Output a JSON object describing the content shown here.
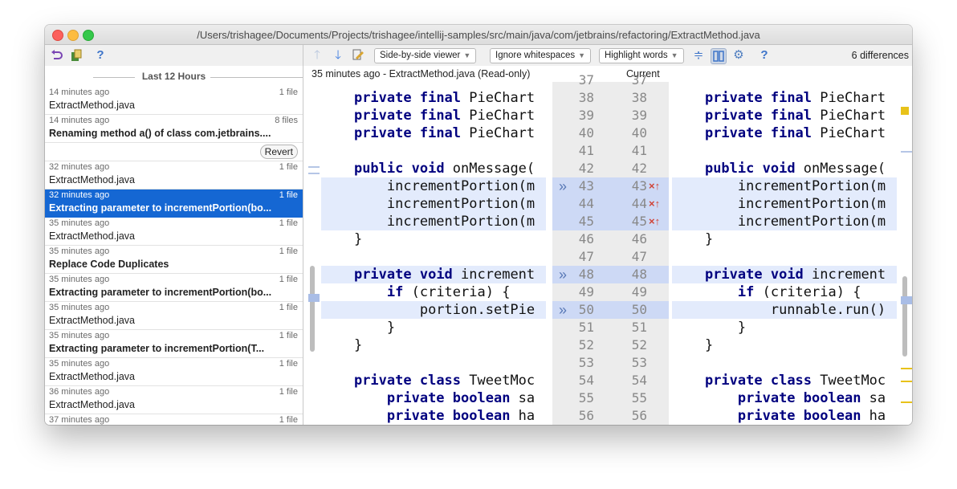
{
  "window": {
    "title": "/Users/trishagee/Documents/Projects/trishagee/intellij-samples/src/main/java/com/jetbrains/refactoring/ExtractMethod.java"
  },
  "left_toolbar": {
    "undo_icon": "undo-icon",
    "copy_icon": "copy-icon",
    "help_label": "?"
  },
  "history": {
    "group_label": "Last 12 Hours",
    "revert_label": "Revert",
    "items": [
      {
        "time": "14 minutes ago",
        "count": "1 file",
        "name": "ExtractMethod.java",
        "bold": false
      },
      {
        "time": "14 minutes ago",
        "count": "8 files",
        "name": "Renaming method a() of class com.jetbrains....",
        "bold": true
      },
      {
        "time": "32 minutes ago",
        "count": "1 file",
        "name": "ExtractMethod.java",
        "bold": false
      },
      {
        "time": "32 minutes ago",
        "count": "1 file",
        "name": "Extracting parameter to incrementPortion(bo...",
        "bold": true
      },
      {
        "time": "35 minutes ago",
        "count": "1 file",
        "name": "ExtractMethod.java",
        "bold": false
      },
      {
        "time": "35 minutes ago",
        "count": "1 file",
        "name": "Replace Code Duplicates",
        "bold": true
      },
      {
        "time": "35 minutes ago",
        "count": "1 file",
        "name": "Extracting parameter to incrementPortion(bo...",
        "bold": true
      },
      {
        "time": "35 minutes ago",
        "count": "1 file",
        "name": "ExtractMethod.java",
        "bold": false
      },
      {
        "time": "35 minutes ago",
        "count": "1 file",
        "name": "Extracting parameter to incrementPortion(T...",
        "bold": true
      },
      {
        "time": "35 minutes ago",
        "count": "1 file",
        "name": "ExtractMethod.java",
        "bold": false
      },
      {
        "time": "36 minutes ago",
        "count": "1 file",
        "name": "ExtractMethod.java",
        "bold": false
      },
      {
        "time": "37 minutes ago",
        "count": "1 file",
        "name": "ExtractMethod.java",
        "bold": false
      }
    ]
  },
  "diff_toolbar": {
    "viewer_mode": "Side-by-side viewer",
    "whitespace_mode": "Ignore whitespaces",
    "highlight_mode": "Highlight words",
    "help_label": "?",
    "differences": "6 differences"
  },
  "left_pane": {
    "header": "35 minutes ago - ExtractMethod.java (Read-only)"
  },
  "right_pane": {
    "header": "Current"
  },
  "colors": {
    "selection": "#1567d3",
    "diff_highlight": "#e3ebfc",
    "gutter_highlight": "#cdd9f5",
    "keyword": "#00007f"
  },
  "left_code": [
    {
      "indent": "    ",
      "segments": [
        {
          "t": "private ",
          "k": true
        },
        {
          "t": "final ",
          "k": true
        },
        {
          "t": "PieChart",
          "k": false
        }
      ],
      "hl": false
    },
    {
      "indent": "    ",
      "segments": [
        {
          "t": "private ",
          "k": true
        },
        {
          "t": "final ",
          "k": true
        },
        {
          "t": "PieChart",
          "k": false
        }
      ],
      "hl": false
    },
    {
      "indent": "    ",
      "segments": [
        {
          "t": "private ",
          "k": true
        },
        {
          "t": "final ",
          "k": true
        },
        {
          "t": "PieChart",
          "k": false
        }
      ],
      "hl": false
    },
    {
      "indent": "",
      "segments": [],
      "hl": false
    },
    {
      "indent": "    ",
      "segments": [
        {
          "t": "public ",
          "k": true
        },
        {
          "t": "void ",
          "k": true
        },
        {
          "t": "onMessage(",
          "k": false
        }
      ],
      "hl": false
    },
    {
      "indent": "        ",
      "segments": [
        {
          "t": "incrementPortion(m",
          "k": false
        }
      ],
      "hl": true
    },
    {
      "indent": "        ",
      "segments": [
        {
          "t": "incrementPortion(m",
          "k": false
        }
      ],
      "hl": true
    },
    {
      "indent": "        ",
      "segments": [
        {
          "t": "incrementPortion(m",
          "k": false
        }
      ],
      "hl": true
    },
    {
      "indent": "    ",
      "segments": [
        {
          "t": "}",
          "k": false
        }
      ],
      "hl": false
    },
    {
      "indent": "",
      "segments": [],
      "hl": false
    },
    {
      "indent": "    ",
      "segments": [
        {
          "t": "private ",
          "k": true
        },
        {
          "t": "void ",
          "k": true
        },
        {
          "t": "increment",
          "k": false
        }
      ],
      "hl": true
    },
    {
      "indent": "        ",
      "segments": [
        {
          "t": "if ",
          "k": true
        },
        {
          "t": "(criteria) {",
          "k": false
        }
      ],
      "hl": false
    },
    {
      "indent": "            ",
      "segments": [
        {
          "t": "portion.setPie",
          "k": false
        }
      ],
      "hl": true
    },
    {
      "indent": "        ",
      "segments": [
        {
          "t": "}",
          "k": false
        }
      ],
      "hl": false
    },
    {
      "indent": "    ",
      "segments": [
        {
          "t": "}",
          "k": false
        }
      ],
      "hl": false
    },
    {
      "indent": "",
      "segments": [],
      "hl": false
    },
    {
      "indent": "    ",
      "segments": [
        {
          "t": "private ",
          "k": true
        },
        {
          "t": "class ",
          "k": true
        },
        {
          "t": "TweetMoc",
          "k": false
        }
      ],
      "hl": false
    },
    {
      "indent": "        ",
      "segments": [
        {
          "t": "private ",
          "k": true
        },
        {
          "t": "boolean ",
          "k": true
        },
        {
          "t": "sa",
          "k": false
        }
      ],
      "hl": false
    },
    {
      "indent": "        ",
      "segments": [
        {
          "t": "private ",
          "k": true
        },
        {
          "t": "boolean ",
          "k": true
        },
        {
          "t": "ha",
          "k": false
        }
      ],
      "hl": false
    }
  ],
  "right_code": [
    {
      "indent": "    ",
      "segments": [
        {
          "t": "private ",
          "k": true
        },
        {
          "t": "final ",
          "k": true
        },
        {
          "t": "PieChart",
          "k": false
        }
      ],
      "hl": false
    },
    {
      "indent": "    ",
      "segments": [
        {
          "t": "private ",
          "k": true
        },
        {
          "t": "final ",
          "k": true
        },
        {
          "t": "PieChart",
          "k": false
        }
      ],
      "hl": false
    },
    {
      "indent": "    ",
      "segments": [
        {
          "t": "private ",
          "k": true
        },
        {
          "t": "final ",
          "k": true
        },
        {
          "t": "PieChart",
          "k": false
        }
      ],
      "hl": false
    },
    {
      "indent": "",
      "segments": [],
      "hl": false
    },
    {
      "indent": "    ",
      "segments": [
        {
          "t": "public ",
          "k": true
        },
        {
          "t": "void ",
          "k": true
        },
        {
          "t": "onMessage(",
          "k": false
        }
      ],
      "hl": false
    },
    {
      "indent": "        ",
      "segments": [
        {
          "t": "incrementPortion(m",
          "k": false
        }
      ],
      "hl": true
    },
    {
      "indent": "        ",
      "segments": [
        {
          "t": "incrementPortion(m",
          "k": false
        }
      ],
      "hl": true
    },
    {
      "indent": "        ",
      "segments": [
        {
          "t": "incrementPortion(m",
          "k": false
        }
      ],
      "hl": true
    },
    {
      "indent": "    ",
      "segments": [
        {
          "t": "}",
          "k": false
        }
      ],
      "hl": false
    },
    {
      "indent": "",
      "segments": [],
      "hl": false
    },
    {
      "indent": "    ",
      "segments": [
        {
          "t": "private ",
          "k": true
        },
        {
          "t": "void ",
          "k": true
        },
        {
          "t": "increment",
          "k": false
        }
      ],
      "hl": true
    },
    {
      "indent": "        ",
      "segments": [
        {
          "t": "if ",
          "k": true
        },
        {
          "t": "(criteria) {",
          "k": false
        }
      ],
      "hl": false
    },
    {
      "indent": "            ",
      "segments": [
        {
          "t": "runnable.run()",
          "k": false
        }
      ],
      "hl": true
    },
    {
      "indent": "        ",
      "segments": [
        {
          "t": "}",
          "k": false
        }
      ],
      "hl": false
    },
    {
      "indent": "    ",
      "segments": [
        {
          "t": "}",
          "k": false
        }
      ],
      "hl": false
    },
    {
      "indent": "",
      "segments": [],
      "hl": false
    },
    {
      "indent": "    ",
      "segments": [
        {
          "t": "private ",
          "k": true
        },
        {
          "t": "class ",
          "k": true
        },
        {
          "t": "TweetMoc",
          "k": false
        }
      ],
      "hl": false
    },
    {
      "indent": "        ",
      "segments": [
        {
          "t": "private ",
          "k": true
        },
        {
          "t": "boolean ",
          "k": true
        },
        {
          "t": "sa",
          "k": false
        }
      ],
      "hl": false
    },
    {
      "indent": "        ",
      "segments": [
        {
          "t": "private ",
          "k": true
        },
        {
          "t": "boolean ",
          "k": true
        },
        {
          "t": "ha",
          "k": false
        }
      ],
      "hl": false
    }
  ],
  "gutter": {
    "left_numbers": [
      "37",
      "38",
      "39",
      "40",
      "41",
      "42",
      "43",
      "44",
      "45",
      "46",
      "47",
      "48",
      "49",
      "50",
      "51",
      "52",
      "53",
      "54",
      "55",
      "56"
    ],
    "right_numbers": [
      "37",
      "38",
      "39",
      "40",
      "41",
      "42",
      "43",
      "44",
      "45",
      "46",
      "47",
      "48",
      "49",
      "50",
      "51",
      "52",
      "53",
      "54",
      "55",
      "56"
    ],
    "changed_lines": [
      "43",
      "44",
      "45",
      "48",
      "50"
    ],
    "apply_markers": [
      "43",
      "48",
      "50"
    ],
    "conflict_markers": [
      "43",
      "44",
      "45"
    ],
    "apply_glyph": "»",
    "conflict_glyph": "×↑"
  }
}
